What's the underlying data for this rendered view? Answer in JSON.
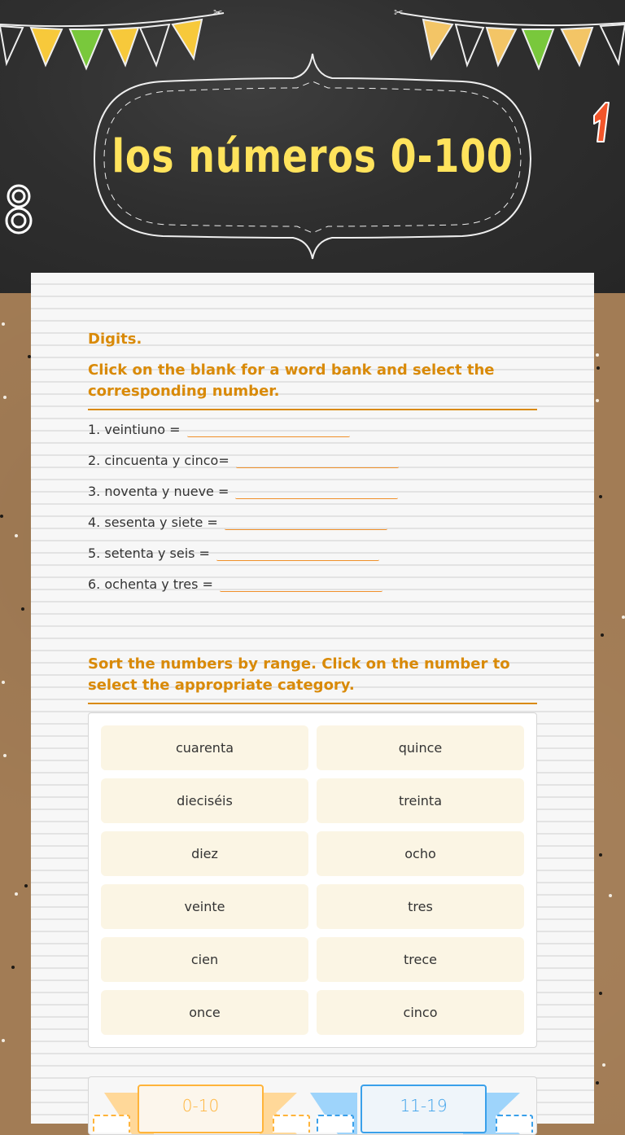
{
  "header": {
    "title": "los números 0-100",
    "decor_left_digit": "8",
    "decor_right_digit": "1"
  },
  "colors": {
    "chalkboard": "#2f2f2f",
    "title_yellow": "#ffe35c",
    "heading_orange": "#d98a08",
    "blank_underline": "#f0902a",
    "tile_bg": "#fbf5e4",
    "cat1": "#ffb43a",
    "cat2": "#3aa0ea"
  },
  "section1": {
    "heading": "Digits.",
    "instructions": "Click on the blank for a word bank and select the corresponding number.",
    "questions": [
      {
        "label": "1. veintiuno =",
        "value": ""
      },
      {
        "label": "2. cincuenta y cinco=",
        "value": ""
      },
      {
        "label": "3. noventa y nueve =",
        "value": ""
      },
      {
        "label": "4. sesenta y siete =",
        "value": ""
      },
      {
        "label": "5. setenta y seis =",
        "value": ""
      },
      {
        "label": "6. ochenta y tres =",
        "value": ""
      }
    ]
  },
  "section2": {
    "instructions": "Sort the numbers by range. Click on the number to select the appropriate category.",
    "tiles": [
      "cuarenta",
      "quince",
      "dieciséis",
      "treinta",
      "diez",
      "ocho",
      "veinte",
      "tres",
      "cien",
      "trece",
      "once",
      "cinco"
    ],
    "categories": [
      {
        "label": "0-10"
      },
      {
        "label": "11-19"
      }
    ]
  }
}
